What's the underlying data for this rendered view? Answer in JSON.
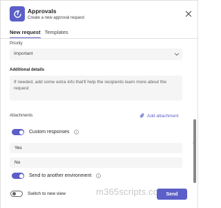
{
  "header": {
    "app_icon": "approvals-icon",
    "title": "Approvals",
    "subtitle": "Create a new approval request",
    "close_icon": "close-icon"
  },
  "tabs": [
    {
      "label": "New request",
      "active": true
    },
    {
      "label": "Templates",
      "active": false
    }
  ],
  "form": {
    "priority": {
      "label": "Priority",
      "value": "Important"
    },
    "details": {
      "label": "Additional details",
      "placeholder": "If needed, add some extra info that'll help the recipients learn more about the request"
    },
    "attachments": {
      "label": "Attachments",
      "add_label": "Add attachment"
    },
    "custom_responses": {
      "label": "Custom responses",
      "enabled": true
    },
    "responses": [
      "Yes",
      "No"
    ],
    "required_marker": "*",
    "send_env": {
      "label": "Send to another environment",
      "enabled": true
    }
  },
  "footer": {
    "new_view_label": "Switch to new view",
    "new_view_enabled": false,
    "send_label": "Send",
    "watermark": "m365scripts.com"
  },
  "colors": {
    "accent": "#5b5fc7",
    "field_bg": "#f5f5f5",
    "required": "#c4314b"
  }
}
